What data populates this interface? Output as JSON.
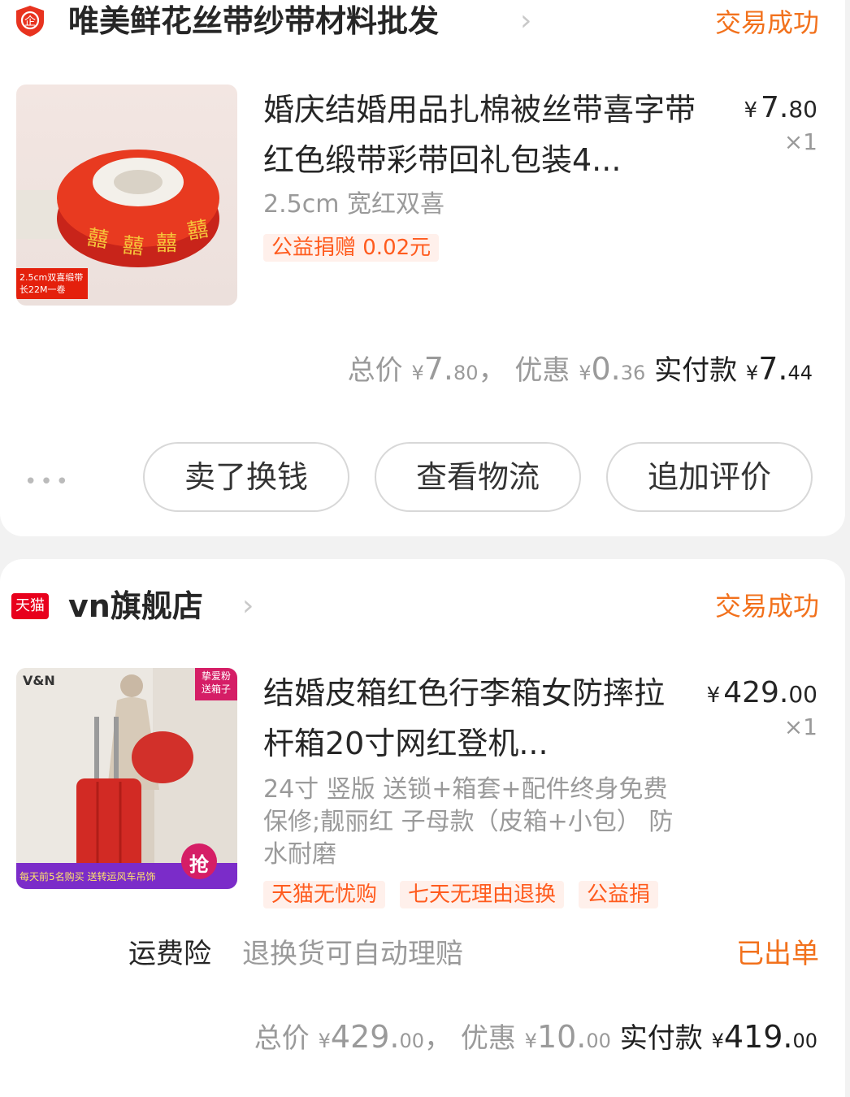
{
  "orders": [
    {
      "shop_name": "唯美鲜花丝带纱带材料批发",
      "status": "交易成功",
      "product_title": "婚庆结婚用品扎棉被丝带喜字带红色缎带彩带回礼包装4...",
      "price_symbol": "¥",
      "price_int": "7.",
      "price_dec": "80",
      "qty": "×1",
      "sku": "2.5cm 宽红双喜",
      "tags": [
        "公益捐赠 0.02元"
      ],
      "thumb_caption": "2.5cm双喜缎带 长22M一卷",
      "summary": {
        "total_label": "总价",
        "total_int": "7.",
        "total_dec": "80",
        "discount_label": "优惠",
        "discount_int": "0.",
        "discount_dec": "36",
        "paid_label": "实付款",
        "paid_int": "7.",
        "paid_dec": "44"
      },
      "more_dots": "•••",
      "buttons": [
        "卖了换钱",
        "查看物流",
        "追加评价"
      ]
    },
    {
      "shop_name": "vn旗舰店",
      "shop_badge": "天猫",
      "status": "交易成功",
      "product_title": "结婚皮箱红色行李箱女防摔拉杆箱20寸网红登机...",
      "price_symbol": "¥",
      "price_int": "429.",
      "price_dec": "00",
      "qty": "×1",
      "sku": "24寸 竖版 送锁+箱套+配件终身免费保修;靓丽红 子母款（皮箱+小包） 防水耐磨",
      "tags": [
        "天猫无忧购",
        "七天无理由退换",
        "公益捐"
      ],
      "thumb_brand": "V&N",
      "thumb_badge": "挚爱粉 送箱子",
      "thumb_banner": "每天前5名购买 送转运风车吊饰",
      "thumb_grab": "抢",
      "insurance": {
        "label": "运费险",
        "desc": "退换货可自动理赔",
        "state": "已出单"
      },
      "summary": {
        "total_label": "总价",
        "total_int": "429.",
        "total_dec": "00",
        "discount_label": "优惠",
        "discount_int": "10.",
        "discount_dec": "00",
        "paid_label": "实付款",
        "paid_int": "419.",
        "paid_dec": "00"
      }
    }
  ]
}
